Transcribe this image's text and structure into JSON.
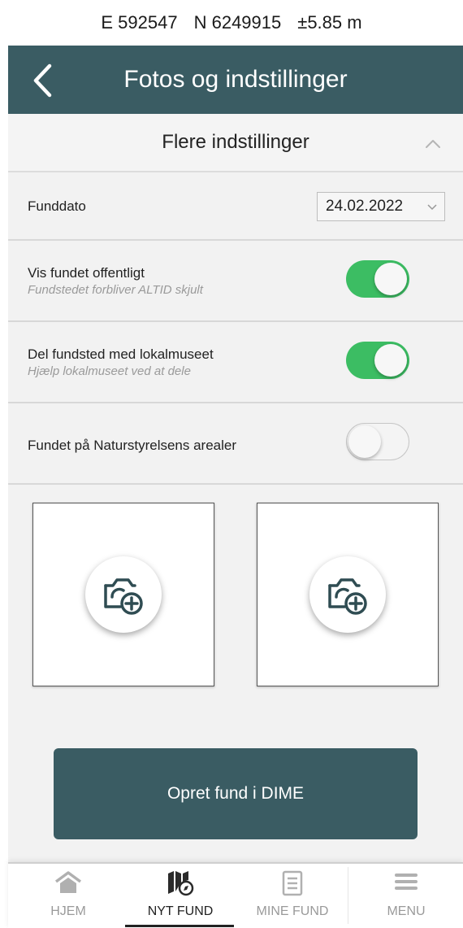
{
  "status_bar": {
    "easting": "E 592547",
    "northing": "N 6249915",
    "accuracy": "±5.85 m"
  },
  "header": {
    "title": "Fotos og indstillinger",
    "back_icon": "chevron-left-icon"
  },
  "section": {
    "title": "Flere indstillinger",
    "icon": "chevron-up-icon"
  },
  "settings": {
    "date": {
      "label": "Funddato",
      "value": "24.02.2022"
    },
    "public": {
      "label": "Vis fundet offentligt",
      "sub": "Fundstedet forbliver ALTID skjult",
      "on": true
    },
    "museum": {
      "label": "Del fundsted med lokalmuseet",
      "sub": "Hjælp lokalmuseet ved at dele",
      "on": true
    },
    "nature": {
      "label": "Fundet på Naturstyrelsens arealer",
      "on": false
    }
  },
  "photos": {
    "icon": "camera-add-icon",
    "count": 2
  },
  "create_button": {
    "label": "Opret fund i DIME"
  },
  "tabs": [
    {
      "label": "HJEM",
      "icon": "home-icon",
      "active": false
    },
    {
      "label": "NYT FUND",
      "icon": "map-pin-icon",
      "active": true
    },
    {
      "label": "MINE FUND",
      "icon": "document-icon",
      "active": false
    },
    {
      "label": "MENU",
      "icon": "menu-icon",
      "active": false
    }
  ],
  "colors": {
    "header": "#3a5c63",
    "toggle_on": "#3cbd63",
    "panel": "#f2f2f2"
  }
}
